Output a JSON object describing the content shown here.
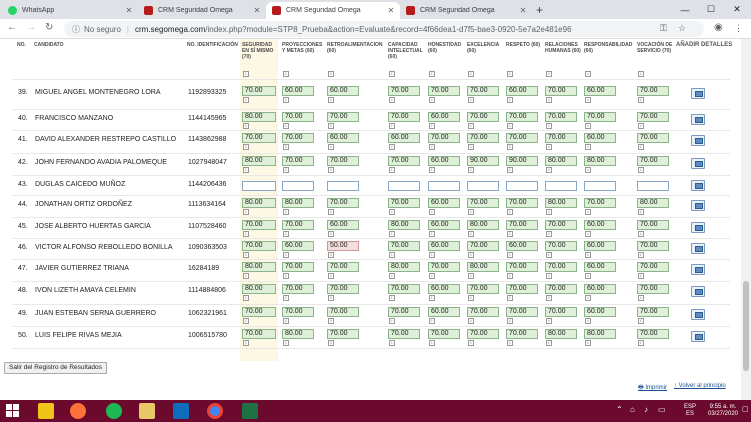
{
  "browser": {
    "tabs": [
      {
        "label": "WhatsApp",
        "icon": "whatsapp-icon"
      },
      {
        "label": "CRM Seguridad Omega",
        "icon": "crm-icon"
      },
      {
        "label": "CRM Seguridad Omega",
        "icon": "crm-icon"
      },
      {
        "label": "CRM Seguridad Omega",
        "icon": "crm-icon"
      }
    ],
    "active_tab": 2,
    "not_secure": "No seguro",
    "url_host": "crm.segomega.com",
    "url_path": "/index.php?module=STP8_Prueba&action=Evaluate&record=4f66dea1-d7f5-bae3-0920-5e7a2e481e96"
  },
  "table": {
    "headers": {
      "no": "No.",
      "candidato": "CANDIDATO",
      "identificacion": "No. IDENTIFICACIÓN",
      "c1": "SEGURIDAD EN SÍ MISMO (70)",
      "c2": "PROYECCIONES Y METAS (60)",
      "c3": "RETROALIMENTACION (60)",
      "c4": "CAPACIDAD INTELECTUAL (60)",
      "c5": "HONESTIDAD (60)",
      "c6": "EXCELENCIA (60)",
      "c7": "RESPETO (60)",
      "c8": "RELACIONES HUMANAS (60)",
      "c9": "RESPONSABILIDAD (60)",
      "c10": "VOCACIÓN DE SERVICIO (70)",
      "detalles": "Añadir Detalles"
    },
    "rows": [
      {
        "no": "39.",
        "name": "MIGUEL ANGEL MONTENEGRO LORA",
        "id": "1192893325",
        "scores": [
          "70.00",
          "60.00",
          "60.00",
          "70.00",
          "70.00",
          "70.00",
          "60.00",
          "70.00",
          "60.00",
          "70.00"
        ]
      },
      {
        "no": "40.",
        "name": "FRANCISCO MANZANO",
        "id": "1144145965",
        "scores": [
          "80.00",
          "70.00",
          "70.00",
          "70.00",
          "60.00",
          "70.00",
          "70.00",
          "70.00",
          "70.00",
          "70.00"
        ]
      },
      {
        "no": "41.",
        "name": "DAVID ALEXANDER RESTREPO CASTILLO",
        "id": "1143862988",
        "scores": [
          "70.00",
          "70.00",
          "60.00",
          "60.00",
          "70.00",
          "70.00",
          "70.00",
          "70.00",
          "60.00",
          "70.00"
        ]
      },
      {
        "no": "42.",
        "name": "JOHN FERNANDO AVADIA PALOMEQUE",
        "id": "1027948047",
        "scores": [
          "80.00",
          "70.00",
          "70.00",
          "70.00",
          "60.00",
          "90.00",
          "90.00",
          "80.00",
          "80.00",
          "70.00"
        ]
      },
      {
        "no": "43.",
        "name": "DUGLAS CAICEDO MUÑOZ",
        "id": "1144206436",
        "scores": [
          "",
          "",
          "",
          "",
          "",
          "",
          "",
          "",
          "",
          ""
        ]
      },
      {
        "no": "44.",
        "name": "JONATHAN ORTIZ ORDOÑEZ",
        "id": "1113634164",
        "scores": [
          "80.00",
          "80.00",
          "70.00",
          "70.00",
          "60.00",
          "70.00",
          "70.00",
          "80.00",
          "70.00",
          "80.00"
        ]
      },
      {
        "no": "45.",
        "name": "JOSE ALBERTO HUERTAS GARCIA",
        "id": "1107528460",
        "scores": [
          "70.00",
          "70.00",
          "60.00",
          "80.00",
          "60.00",
          "80.00",
          "70.00",
          "70.00",
          "60.00",
          "70.00"
        ]
      },
      {
        "no": "46.",
        "name": "VICTOR ALFONSO REBOLLEDO BONILLA",
        "id": "1090363503",
        "scores": [
          "70.00",
          "60.00",
          "50.00",
          "70.00",
          "60.00",
          "70.00",
          "60.00",
          "70.00",
          "60.00",
          "70.00"
        ]
      },
      {
        "no": "47.",
        "name": "JAVIER GUTIERREZ TRIANA",
        "id": "16284189",
        "scores": [
          "80.00",
          "70.00",
          "70.00",
          "80.00",
          "70.00",
          "80.00",
          "70.00",
          "70.00",
          "60.00",
          "70.00"
        ]
      },
      {
        "no": "48.",
        "name": "IVON LIZETH AMAYA CELEMIN",
        "id": "1114884806",
        "scores": [
          "80.00",
          "70.00",
          "70.00",
          "70.00",
          "60.00",
          "70.00",
          "70.00",
          "70.00",
          "60.00",
          "70.00"
        ]
      },
      {
        "no": "49.",
        "name": "JUAN ESTEBAN SERNA GUERRERO",
        "id": "1062321961",
        "scores": [
          "70.00",
          "70.00",
          "70.00",
          "70.00",
          "60.00",
          "70.00",
          "70.00",
          "70.00",
          "60.00",
          "70.00"
        ]
      },
      {
        "no": "50.",
        "name": "LUIS FELIPE RIVAS MEJIA",
        "id": "1006515780",
        "scores": [
          "70.00",
          "80.00",
          "70.00",
          "70.00",
          "70.00",
          "70.00",
          "70.00",
          "80.00",
          "80.00",
          "70.00"
        ]
      }
    ]
  },
  "actions": {
    "exit_label": "Salir del Registro de Resultados",
    "print_label": "Imprimir",
    "top_label": "Volver al principio"
  },
  "taskbar": {
    "lang1": "ESP",
    "lang2": "ES",
    "time": "9:55 a. m.",
    "date": "03/27/2020"
  },
  "colors": {
    "score_fill": "#dff0d8",
    "score_warn_fill": "#f2dede",
    "highlight_column": "#fcf8e3",
    "taskbar": "#6b0a2d"
  }
}
